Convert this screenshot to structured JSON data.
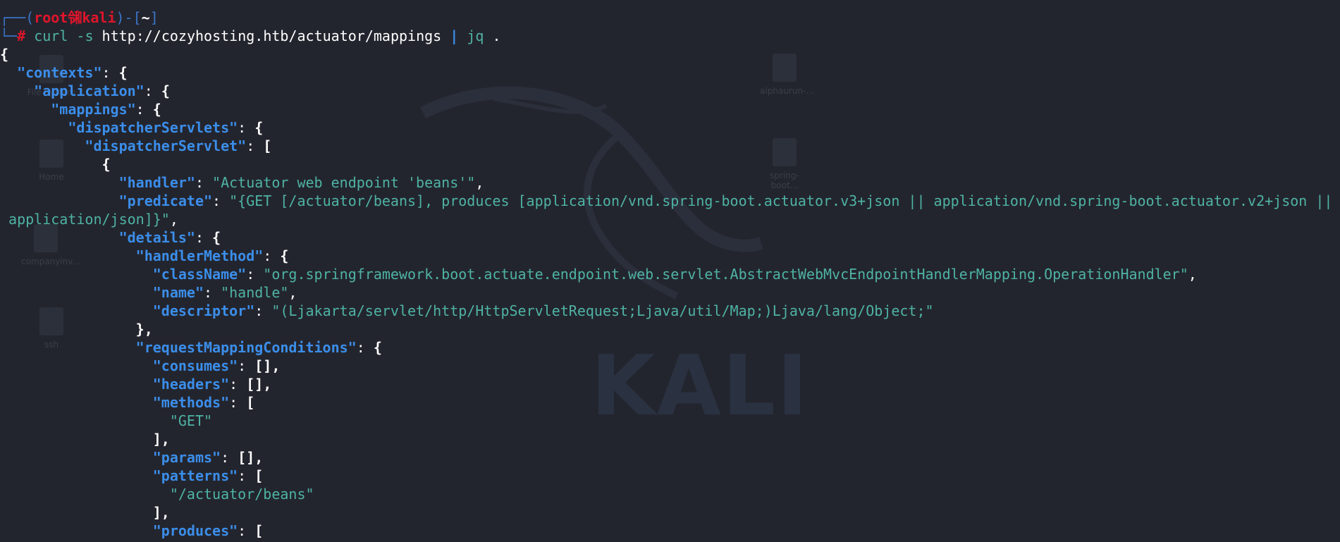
{
  "prompt": {
    "user": "root",
    "separator_glyph": "㋿",
    "host": "kali",
    "cwd": "~",
    "command": {
      "executable": "curl",
      "flag": "-s",
      "url": "http://cozyhosting.htb/actuator/mappings",
      "pipe": "|",
      "filter_cmd": "jq",
      "filter_arg": "."
    }
  },
  "output": {
    "open_root": "{",
    "contexts_key": "\"contexts\"",
    "application_key": "\"application\"",
    "mappings_key": "\"mappings\"",
    "dispatcherServlets_key": "\"dispatcherServlets\"",
    "dispatcherServlet_key": "\"dispatcherServlet\"",
    "open_obj": "{",
    "open_arr": "[",
    "handler_key": "\"handler\"",
    "handler_value": "\"Actuator web endpoint 'beans'\"",
    "predicate_key": "\"predicate\"",
    "predicate_value_line1": "\"{GET [/actuator/beans], produces [application/vnd.spring-boot.actuator.v3+json || application/vnd.spring-boot.actuator.v2+json ||",
    "predicate_value_line2": "application/json]}\"",
    "details_key": "\"details\"",
    "handlerMethod_key": "\"handlerMethod\"",
    "className_key": "\"className\"",
    "className_value": "\"org.springframework.boot.actuate.endpoint.web.servlet.AbstractWebMvcEndpointHandlerMapping.OperationHandler\"",
    "name_key": "\"name\"",
    "name_value": "\"handle\"",
    "descriptor_key": "\"descriptor\"",
    "descriptor_value": "\"(Ljakarta/servlet/http/HttpServletRequest;Ljava/util/Map;)Ljava/lang/Object;\"",
    "close_obj_comma": "},",
    "requestMappingConditions_key": "\"requestMappingConditions\"",
    "consumes_key": "\"consumes\"",
    "headers_key": "\"headers\"",
    "methods_key": "\"methods\"",
    "methods_value": "\"GET\"",
    "params_key": "\"params\"",
    "patterns_key": "\"patterns\"",
    "patterns_value": "\"/actuator/beans\"",
    "produces_key": "\"produces\"",
    "empty_arr_comma": "[],",
    "close_arr_comma": "],",
    "colon": ": ",
    "comma": ","
  },
  "desktop": {
    "wallpaper_word": "KALI",
    "icons": [
      "File System",
      "Home",
      "companyinv...",
      "ssh",
      "alphaurun-...",
      "spring-boot..."
    ]
  },
  "colors": {
    "background": "#23252e",
    "json_key": "#3b8eea",
    "json_string": "#4eb3a4",
    "prompt_root": "#e0152b",
    "prompt_frame": "#3b74c8"
  }
}
